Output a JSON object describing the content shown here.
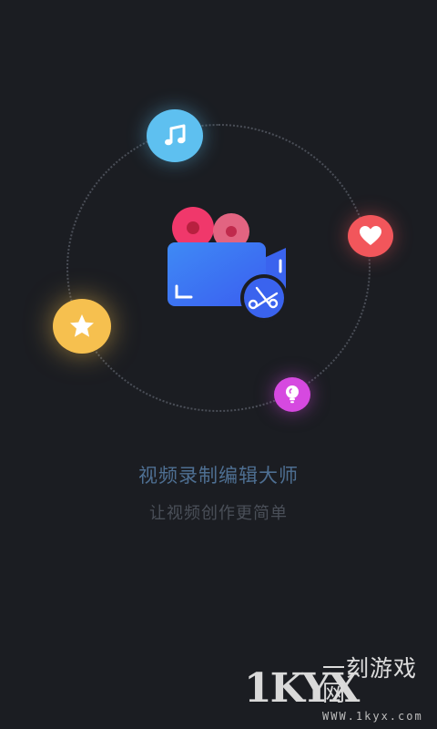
{
  "app": {
    "title": "视频录制编辑大师",
    "subtitle": "让视频创作更简单"
  },
  "icons": {
    "music": "music-note-icon",
    "heart": "heart-icon",
    "star": "star-icon",
    "bulb": "lightbulb-icon",
    "camera": "video-camera-icon",
    "scissors": "scissors-icon"
  },
  "colors": {
    "background": "#1b1d22",
    "music": "#5ec0f0",
    "heart": "#f2565b",
    "star": "#f6c04f",
    "bulb": "#d649e0",
    "camera": "#3f7cf6",
    "reel": "#f0386b"
  },
  "watermark": {
    "logo": "1KYX",
    "text": "一刻游戏网",
    "url": "WWW.1kyx.com"
  }
}
